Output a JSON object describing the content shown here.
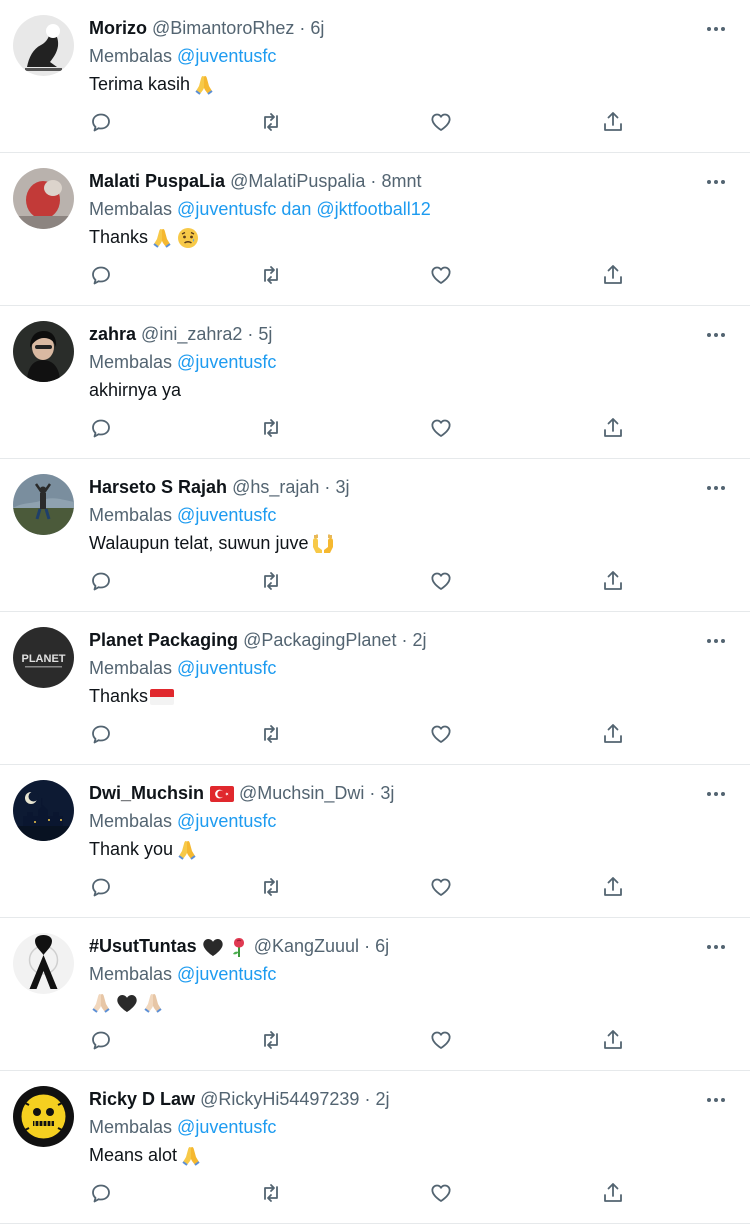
{
  "colors": {
    "accent": "#1d9bf0",
    "secondary_text": "#536471",
    "divider": "#e6e9eb"
  },
  "tweets": [
    {
      "name": "Morizo",
      "handle": "@BimantoroRhez",
      "dot": "·",
      "time": "6j",
      "reply_prefix": "Membalas",
      "mentions": "@juventusfc",
      "text": "Terima kasih",
      "emoji": [
        "folded-hands-icon"
      ]
    },
    {
      "name": "Malati PuspaLia",
      "handle": "@MalatiPuspalia",
      "dot": "·",
      "time": "8mnt",
      "reply_prefix": "Membalas",
      "mentions": "@juventusfc dan @jktfootball12",
      "text": "Thanks",
      "emoji": [
        "folded-hands-icon",
        "sad-face-icon"
      ]
    },
    {
      "name": "zahra",
      "handle": "@ini_zahra2",
      "dot": "·",
      "time": "5j",
      "reply_prefix": "Membalas",
      "mentions": "@juventusfc",
      "text": "akhirnya ya",
      "emoji": []
    },
    {
      "name": "Harseto S Rajah",
      "handle": "@hs_rajah",
      "dot": "·",
      "time": "3j",
      "reply_prefix": "Membalas",
      "mentions": "@juventusfc",
      "text": "Walaupun telat, suwun juve",
      "emoji": [
        "open-hands-icon"
      ]
    },
    {
      "name": "Planet Packaging",
      "handle": "@PackagingPlanet",
      "dot": "·",
      "time": "2j",
      "reply_prefix": "Membalas",
      "mentions": "@juventusfc",
      "text": "Thanks",
      "emoji": [
        "indonesia-flag-icon"
      ]
    },
    {
      "name": "Dwi_Muchsin",
      "handle": "@Muchsin_Dwi",
      "dot": "·",
      "time": "3j",
      "reply_prefix": "Membalas",
      "mentions": "@juventusfc",
      "text": "Thank you",
      "emoji": [
        "folded-hands-icon"
      ]
    },
    {
      "name": "#UsutTuntas",
      "handle": "@KangZuuul",
      "dot": "·",
      "time": "6j",
      "reply_prefix": "Membalas",
      "mentions": "@juventusfc",
      "text": "",
      "emoji": [
        "folded-hands-light-icon",
        "black-heart-icon",
        "folded-hands-light-icon"
      ]
    },
    {
      "name": "Ricky D Law",
      "handle": "@RickyHi54497239",
      "dot": "·",
      "time": "2j",
      "reply_prefix": "Membalas",
      "mentions": "@juventusfc",
      "text": "Means alot",
      "emoji": [
        "folded-hands-icon"
      ]
    }
  ],
  "avatars": [
    {
      "bg": "#e8e8e8",
      "fg": "#222222"
    },
    {
      "bg": "#b9b2ad",
      "fg": "#c23a38"
    },
    {
      "bg": "#2a2d2a",
      "fg": "#6d7a63"
    },
    {
      "bg": "#7a8e9e",
      "fg": "#4b5a3a"
    },
    {
      "bg": "#2b2b2b",
      "fg": "#e0e0e0",
      "text": "PLANET"
    },
    {
      "bg": "#0d1a33",
      "fg": "#3c5d8a"
    },
    {
      "bg": "#f2f2f2",
      "fg": "#111111"
    },
    {
      "bg": "#111111",
      "fg": "#f5d020"
    }
  ],
  "actions": [
    "reply-icon",
    "retweet-icon",
    "like-icon",
    "share-icon"
  ]
}
